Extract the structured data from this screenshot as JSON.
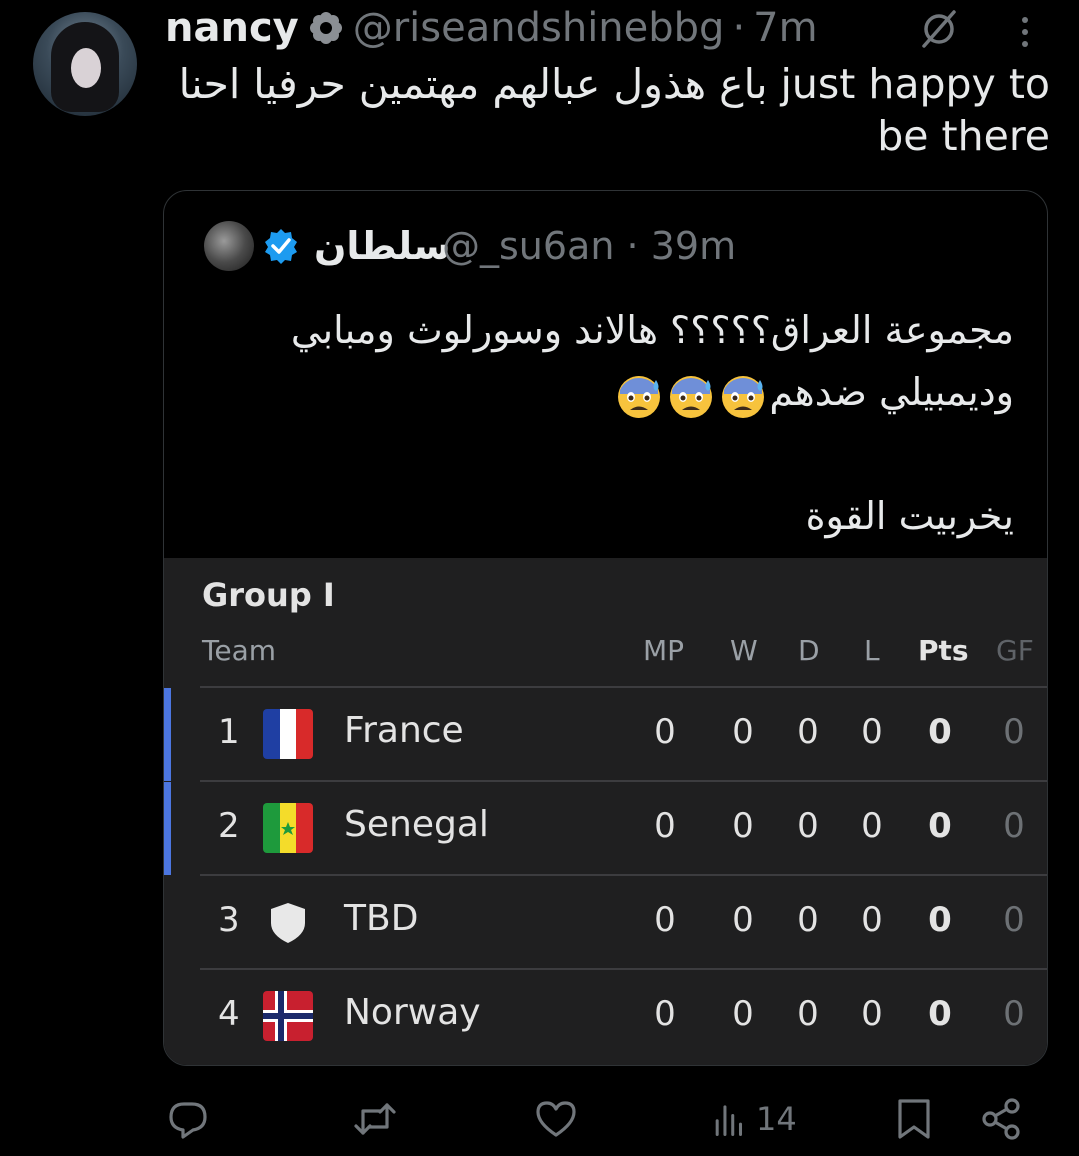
{
  "author": {
    "name": "nancy",
    "handle": "@riseandshinebbg",
    "separator": "·",
    "time": "7m",
    "icons": {
      "badge": "flower-badge-icon",
      "mute": "mute-icon",
      "more": "more-vertical-icon"
    }
  },
  "tweet": {
    "line1": "باع هذول عبالهم مهتمين حرفيا احنا just happy to",
    "line2": "be there"
  },
  "quote": {
    "name": "سلطان",
    "handle": "@_su6an",
    "separator": "·",
    "time": "39m",
    "verified_color": "#1d9bf0",
    "text_line1": "مجموعة العراق؟؟؟؟؟ هالاند وسورلوث ومبابي",
    "text_line2": "وديمبيلي ضدهم",
    "emoji": "anxious-face-with-sweat",
    "text_line4": "يخربيت القوة"
  },
  "standings": {
    "title": "Group I",
    "headers": {
      "team": "Team",
      "mp": "MP",
      "w": "W",
      "d": "D",
      "l": "L",
      "pts": "Pts",
      "gf": "GF"
    },
    "accent_color": "#4c76e0",
    "rows": [
      {
        "pos": "1",
        "team": "France",
        "flag": "france-flag",
        "mp": "0",
        "w": "0",
        "d": "0",
        "l": "0",
        "pts": "0",
        "gf": "0"
      },
      {
        "pos": "2",
        "team": "Senegal",
        "flag": "senegal-flag",
        "mp": "0",
        "w": "0",
        "d": "0",
        "l": "0",
        "pts": "0",
        "gf": "0"
      },
      {
        "pos": "3",
        "team": "TBD",
        "flag": "shield-placeholder",
        "mp": "0",
        "w": "0",
        "d": "0",
        "l": "0",
        "pts": "0",
        "gf": "0"
      },
      {
        "pos": "4",
        "team": "Norway",
        "flag": "norway-flag",
        "mp": "0",
        "w": "0",
        "d": "0",
        "l": "0",
        "pts": "0",
        "gf": "0"
      }
    ]
  },
  "actions": {
    "views": "14",
    "icons": [
      "reply-icon",
      "retweet-icon",
      "like-icon",
      "views-icon",
      "bookmark-icon",
      "share-icon"
    ]
  }
}
